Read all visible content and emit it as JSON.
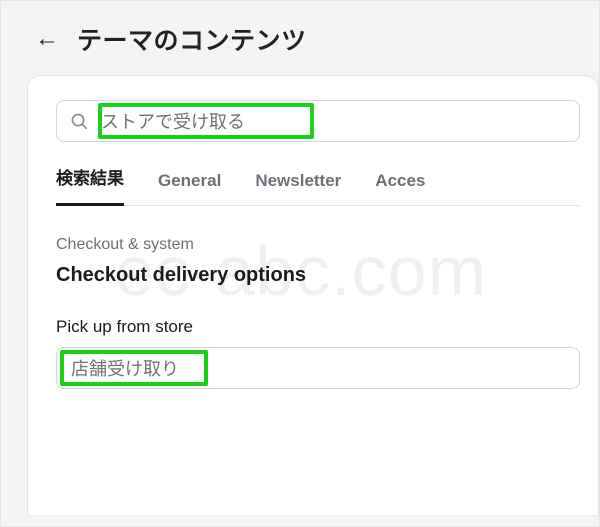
{
  "header": {
    "title": "テーマのコンテンツ"
  },
  "search": {
    "value": "ストアで受け取る"
  },
  "tabs": {
    "items": [
      {
        "label": "検索結果"
      },
      {
        "label": "General"
      },
      {
        "label": "Newsletter"
      },
      {
        "label": "Acces"
      }
    ]
  },
  "result": {
    "kicker": "Checkout & system",
    "title": "Checkout delivery options",
    "field_label": "Pick up from store",
    "field_value": "店舗受け取り"
  },
  "watermark": "ec-abc.com"
}
